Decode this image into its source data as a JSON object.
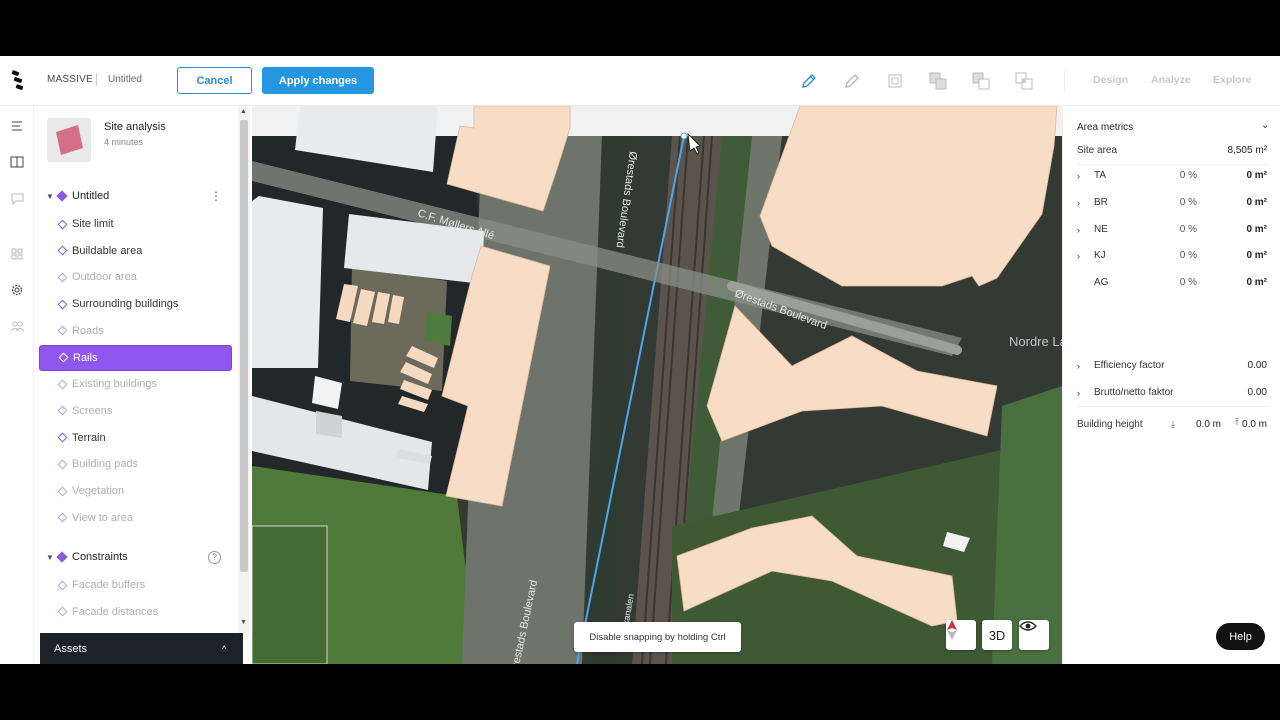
{
  "app": {
    "brand": "MASSIVE",
    "doc_name": "Untitled"
  },
  "toolbar": {
    "cancel_label": "Cancel",
    "apply_label": "Apply changes",
    "modes": [
      "Design",
      "Analyze",
      "Explore"
    ]
  },
  "site": {
    "title": "Site analysis",
    "subtitle": "4 minutes"
  },
  "groups": {
    "untitled": "Untitled",
    "constraints": "Constraints"
  },
  "layers": [
    {
      "label": "Site limit",
      "state": "on"
    },
    {
      "label": "Buildable area",
      "state": "on"
    },
    {
      "label": "Outdoor area",
      "state": "off"
    },
    {
      "label": "Surrounding buildings",
      "state": "on"
    },
    {
      "label": "Roads",
      "state": "off"
    },
    {
      "label": "Rails",
      "state": "active"
    },
    {
      "label": "Existing buildings",
      "state": "off"
    },
    {
      "label": "Screens",
      "state": "off"
    },
    {
      "label": "Terrain",
      "state": "on"
    },
    {
      "label": "Building pads",
      "state": "off"
    },
    {
      "label": "Vegetation",
      "state": "off"
    },
    {
      "label": "View to area",
      "state": "off"
    }
  ],
  "constraint_layers": [
    {
      "label": "Facade buffers",
      "state": "off"
    },
    {
      "label": "Facade distances",
      "state": "off"
    }
  ],
  "assets_label": "Assets",
  "map": {
    "snap_note": "Disable snapping by holding Ctrl",
    "view_mode": "3D",
    "street_labels": [
      "C.F. Møllers Allé",
      "Ørestads Boulevard",
      "Ørestads Boulevard",
      "Nordre Landkanal",
      "Ørestads Boulevard",
      "Hovedkanalen"
    ]
  },
  "metrics": {
    "title": "Area metrics",
    "site_area_label": "Site area",
    "site_area_value": "8,505 m²",
    "rows": [
      {
        "label": "TA",
        "pct": "0 %",
        "value": "0 m²"
      },
      {
        "label": "BR",
        "pct": "0 %",
        "value": "0 m²"
      },
      {
        "label": "NE",
        "pct": "0 %",
        "value": "0 m²"
      },
      {
        "label": "KJ",
        "pct": "0 %",
        "value": "0 m²"
      },
      {
        "label": "AG",
        "pct": "0 %",
        "value": "0 m²"
      }
    ],
    "efficiency_label": "Efficiency factor",
    "efficiency_value": "0.00",
    "brutto_label": "Brutto/netto faktor",
    "brutto_value": "0.00",
    "height_label": "Building height",
    "height_min": "0.0 m",
    "height_max": "0.0 m"
  },
  "help_label": "Help",
  "colors": {
    "accent": "#2596e0",
    "layer_active": "#8e58ee",
    "building_fill": "#f8ddc6"
  }
}
